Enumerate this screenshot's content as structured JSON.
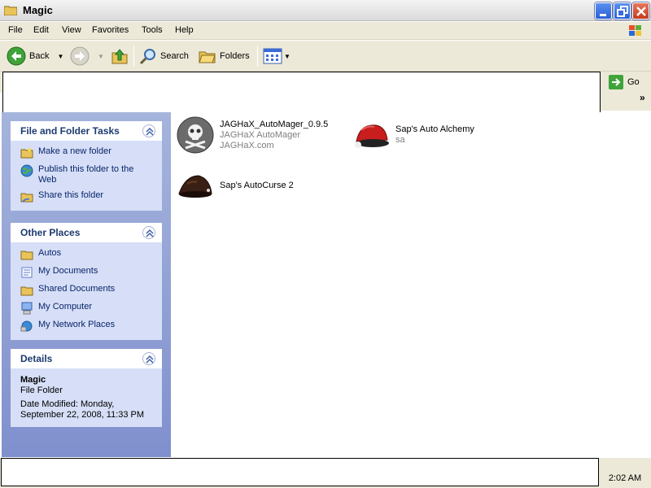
{
  "window": {
    "title": "Magic"
  },
  "menu": [
    "File",
    "Edit",
    "View",
    "Favorites",
    "Tools",
    "Help"
  ],
  "toolbar": {
    "back_label": "Back",
    "search_label": "Search",
    "folders_label": "Folders"
  },
  "address": {
    "go_label": "Go"
  },
  "tasks_panel": {
    "title": "File and Folder Tasks",
    "items": [
      {
        "label": "Make a new folder",
        "icon": "new-folder-icon"
      },
      {
        "label": "Publish this folder to the Web",
        "icon": "publish-web-icon"
      },
      {
        "label": "Share this folder",
        "icon": "share-folder-icon"
      }
    ]
  },
  "places_panel": {
    "title": "Other Places",
    "items": [
      {
        "label": "Autos",
        "icon": "folder-icon"
      },
      {
        "label": "My Documents",
        "icon": "my-documents-icon"
      },
      {
        "label": "Shared Documents",
        "icon": "folder-icon"
      },
      {
        "label": "My Computer",
        "icon": "my-computer-icon"
      },
      {
        "label": "My Network Places",
        "icon": "network-places-icon"
      }
    ]
  },
  "details_panel": {
    "title": "Details",
    "name": "Magic",
    "type": "File Folder",
    "modified": "Date Modified: Monday, September 22, 2008, 11:33 PM"
  },
  "files": [
    {
      "name": "JAGHaX_AutoMager_0.9.5",
      "line2": "JAGHaX AutoMager",
      "line3": "JAGHaX.com",
      "icon": "skull-icon"
    },
    {
      "name": "Sap's Auto Alchemy",
      "line2": "sa",
      "line3": "",
      "icon": "santa-hat-icon"
    },
    {
      "name": "Sap's AutoCurse 2",
      "line2": "",
      "line3": "",
      "icon": "dark-hat-icon"
    }
  ],
  "status": {
    "clock": "2:02 AM"
  },
  "colors": {
    "taskpane": "#8090ce",
    "panel_body": "#d6dff7",
    "link": "#0a246a",
    "titlebar_close": "#c53a1a"
  }
}
